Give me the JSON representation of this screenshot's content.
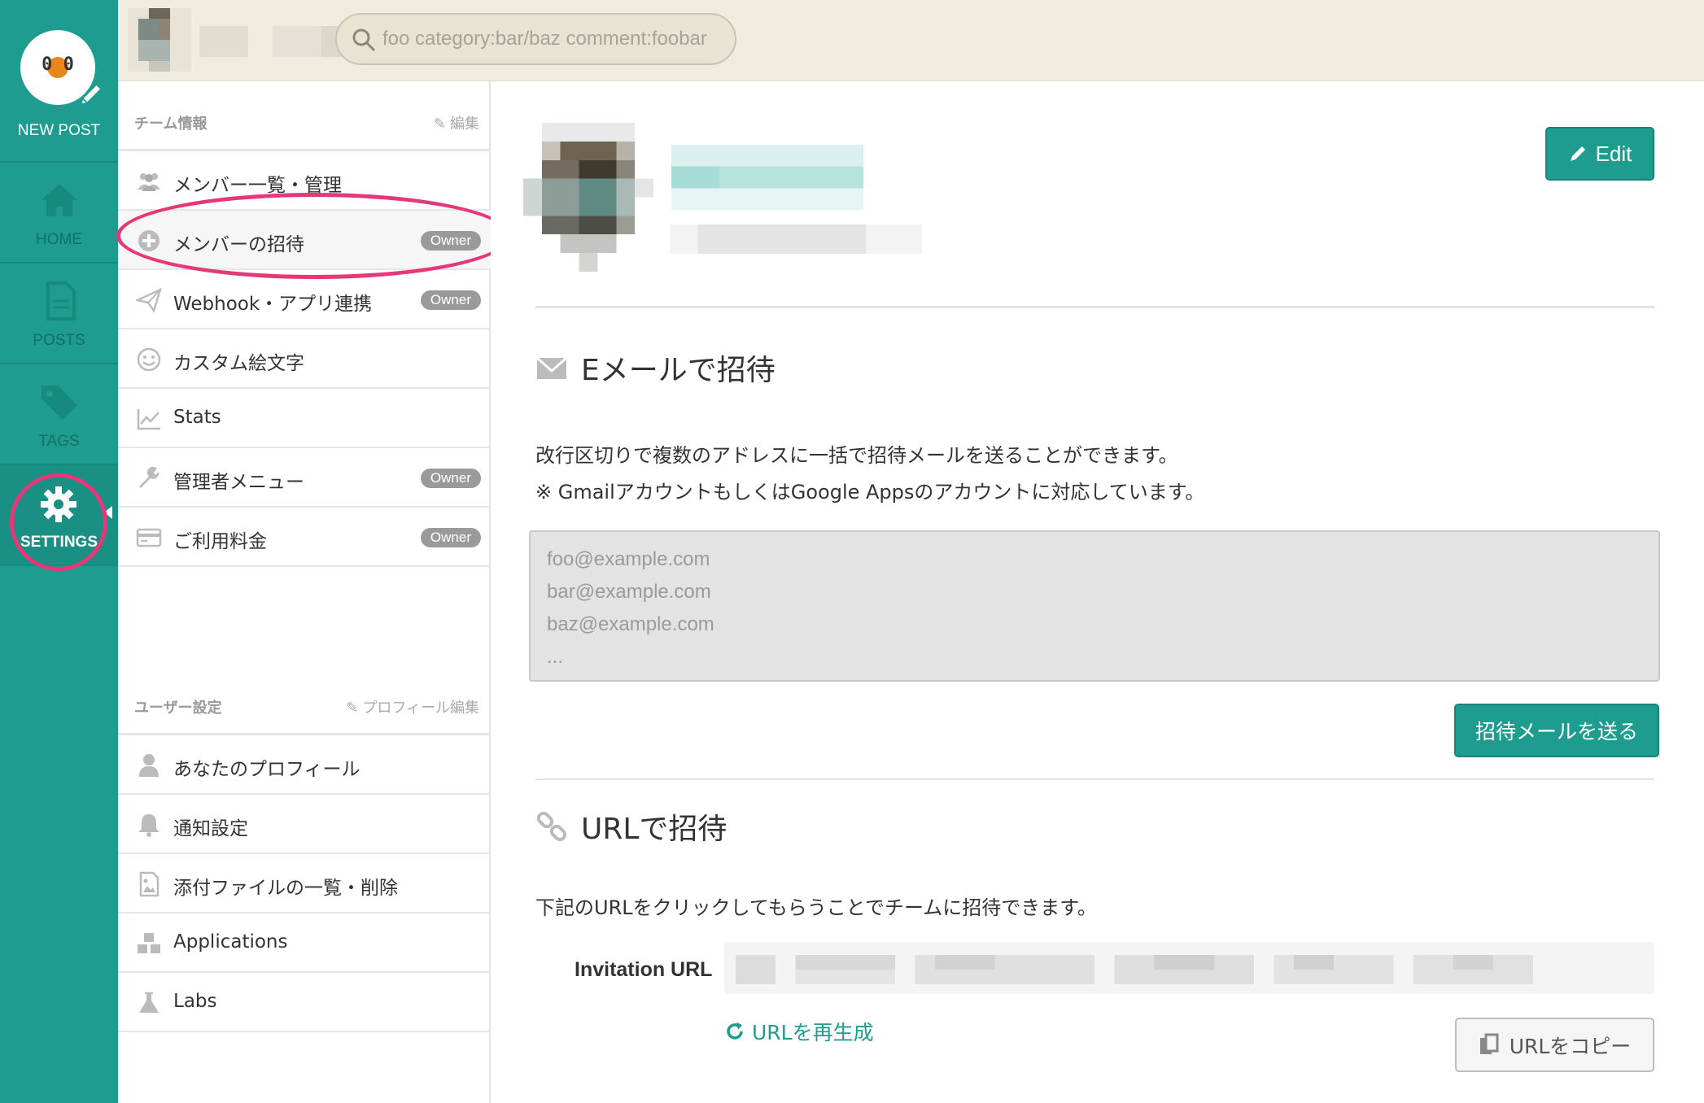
{
  "leftnav": {
    "new_post": "NEW POST",
    "logo_text": "0   0",
    "items": [
      {
        "label": "HOME",
        "icon": "home-icon"
      },
      {
        "label": "POSTS",
        "icon": "document-icon"
      },
      {
        "label": "TAGS",
        "icon": "tag-icon"
      },
      {
        "label": "SETTINGS",
        "icon": "gear-icon"
      }
    ]
  },
  "topbar": {
    "search_placeholder": "foo category:bar/baz comment:foobar"
  },
  "settings": {
    "team_section": {
      "title": "チーム情報",
      "edit": "編集"
    },
    "team_items": [
      {
        "label": "メンバー一覧・管理",
        "icon": "members-icon",
        "badge": ""
      },
      {
        "label": "メンバーの招待",
        "icon": "plus-circle-icon",
        "badge": "Owner"
      },
      {
        "label": "Webhook・アプリ連携",
        "icon": "paper-plane-icon",
        "badge": "Owner"
      },
      {
        "label": "カスタム絵文字",
        "icon": "smile-icon",
        "badge": ""
      },
      {
        "label": "Stats",
        "icon": "line-chart-icon",
        "badge": ""
      },
      {
        "label": "管理者メニュー",
        "icon": "wrench-icon",
        "badge": "Owner"
      },
      {
        "label": "ご利用料金",
        "icon": "credit-card-icon",
        "badge": "Owner"
      }
    ],
    "user_section": {
      "title": "ユーザー設定",
      "edit": "プロフィール編集"
    },
    "user_items": [
      {
        "label": "あなたのプロフィール",
        "icon": "user-icon"
      },
      {
        "label": "通知設定",
        "icon": "bell-icon"
      },
      {
        "label": "添付ファイルの一覧・削除",
        "icon": "image-file-icon"
      },
      {
        "label": "Applications",
        "icon": "cubes-icon"
      },
      {
        "label": "Labs",
        "icon": "flask-icon"
      }
    ]
  },
  "main": {
    "edit_button": "Edit",
    "email_section": {
      "title": "Eメールで招待",
      "desc1": "改行区切りで複数のアドレスに一括で招待メールを送ることができます。",
      "desc2": "※ GmailアカウントもしくはGoogle Appsのアカウントに対応しています。",
      "placeholder": "foo@example.com\nbar@example.com\nbaz@example.com\n...",
      "send_button": "招待メールを送る"
    },
    "url_section": {
      "title": "URLで招待",
      "desc": "下記のURLをクリックしてもらうことでチームに招待できます。",
      "invitation_label": "Invitation URL",
      "regenerate": "URLを再生成",
      "copy_button": "URLをコピー"
    }
  },
  "colors": {
    "brand": "#1e9c8f",
    "highlight": "#e5377a",
    "badge": "#9a9a9a"
  }
}
